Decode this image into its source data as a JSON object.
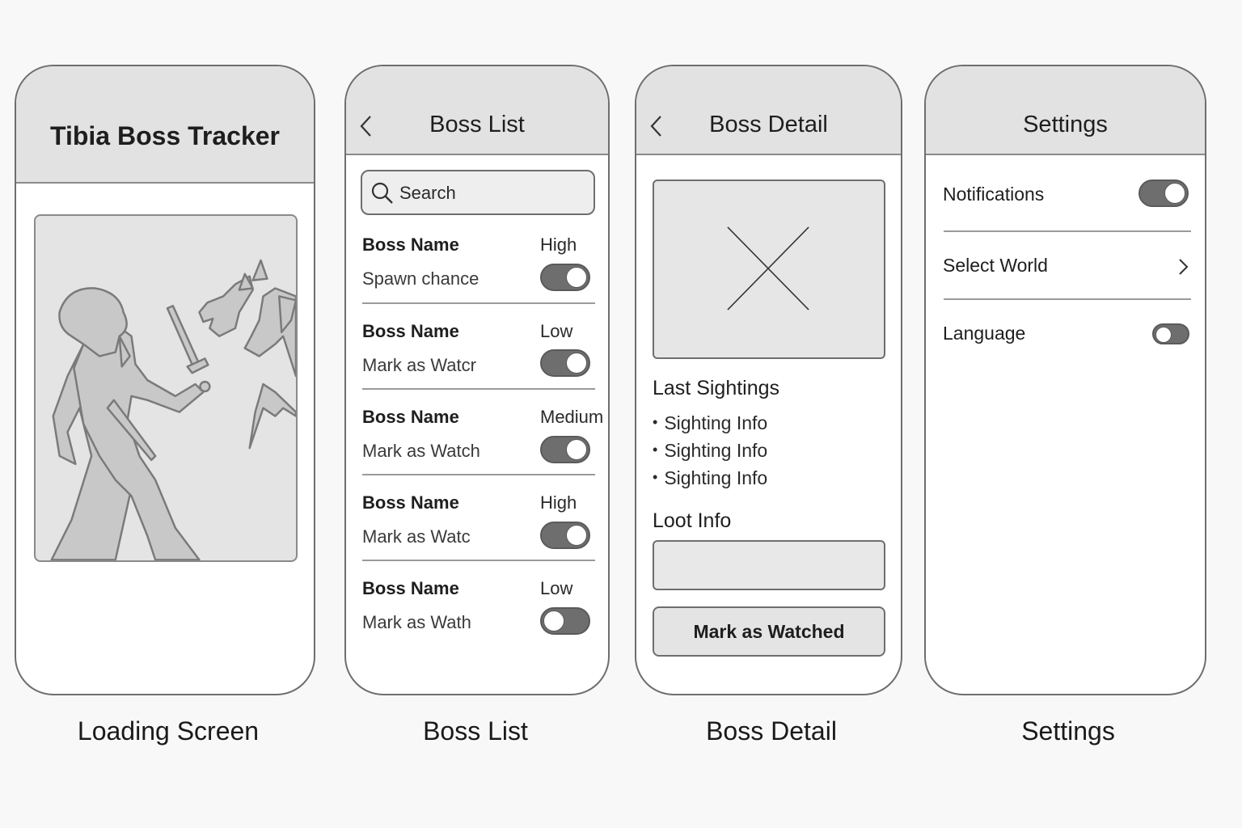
{
  "screens": {
    "loading": {
      "title": "Tibia Boss Tracker",
      "caption": "Loading Screen",
      "hero_icon": "knight-vs-dragon-illustration"
    },
    "boss_list": {
      "title": "Boss List",
      "caption": "Boss List",
      "back_icon": "chevron-left-icon",
      "search": {
        "placeholder": "Search",
        "icon": "search-icon"
      },
      "bosses": [
        {
          "name": "Boss Name",
          "sub": "Spawn chance",
          "chance": "High",
          "toggle_on": true
        },
        {
          "name": "Boss Name",
          "sub": "Mark as Watcr",
          "chance": "Low",
          "toggle_on": true
        },
        {
          "name": "Boss Name",
          "sub": "Mark as Watch",
          "chance": "Medium",
          "toggle_on": true
        },
        {
          "name": "Boss Name",
          "sub": "Mark as Watc",
          "chance": "High",
          "toggle_on": true
        },
        {
          "name": "Boss Name",
          "sub": "Mark as Wath",
          "chance": "Low",
          "toggle_on": false
        }
      ]
    },
    "boss_detail": {
      "title": "Boss Detail",
      "caption": "Boss Detail",
      "back_icon": "chevron-left-icon",
      "image_icon": "image-placeholder-icon",
      "last_sightings_title": "Last Sightings",
      "sightings": [
        "Sighting Info",
        "Sighting Info",
        "Sighting Info"
      ],
      "loot_title": "Loot Info",
      "loot_value": "",
      "watch_button": "Mark as Watched"
    },
    "settings": {
      "title": "Settings",
      "caption": "Settings",
      "notifications_label": "Notifications",
      "notifications_on": true,
      "world_label": "Select World",
      "language_label": "Language",
      "language_on": false
    }
  },
  "colors": {
    "header_bg": "#e2e2e2",
    "toggle_track": "#6e6e6e",
    "border": "#6e6e6e",
    "page_bg": "#f8f8f8"
  }
}
